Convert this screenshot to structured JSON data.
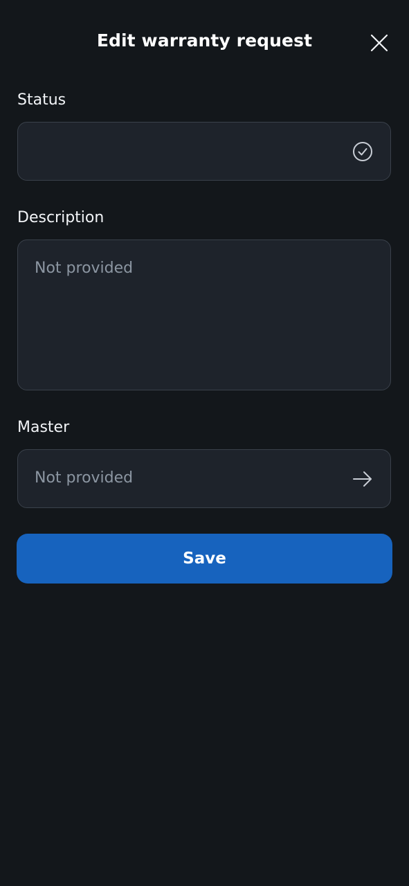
{
  "header": {
    "title": "Edit warranty request",
    "close_icon": "close-icon"
  },
  "fields": {
    "status": {
      "label": "Status",
      "value": "",
      "icon": "check-circle-icon"
    },
    "description": {
      "label": "Description",
      "placeholder": "Not provided"
    },
    "master": {
      "label": "Master",
      "placeholder": "Not provided",
      "icon": "arrow-right-icon"
    }
  },
  "actions": {
    "save_label": "Save"
  },
  "colors": {
    "background": "#13171b",
    "field_background": "#1e232b",
    "field_border": "#3a414b",
    "placeholder": "#8c96a2",
    "primary": "#1763be"
  }
}
